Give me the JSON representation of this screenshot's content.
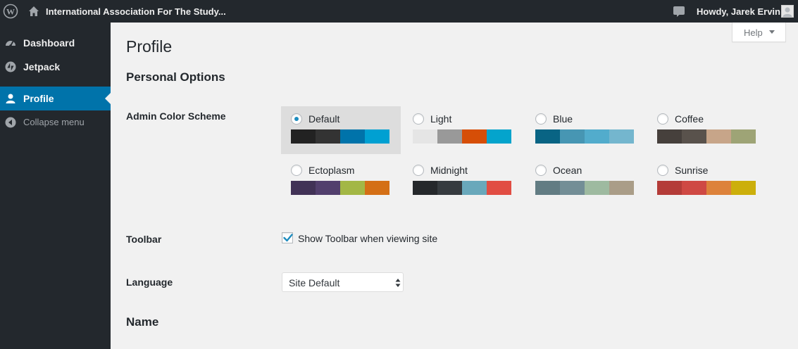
{
  "admin_bar": {
    "site_name": "International Association For The Study...",
    "greeting": "Howdy, Jarek Ervin"
  },
  "sidebar": {
    "items": [
      {
        "label": "Dashboard",
        "icon": "dashboard-icon"
      },
      {
        "label": "Jetpack",
        "icon": "jetpack-icon"
      },
      {
        "label": "Profile",
        "icon": "user-icon",
        "current": true
      },
      {
        "label": "Collapse menu",
        "icon": "collapse-icon"
      }
    ]
  },
  "help": {
    "label": "Help"
  },
  "page": {
    "title": "Profile",
    "personal_options_heading": "Personal Options",
    "admin_color_scheme_label": "Admin Color Scheme",
    "toolbar_label": "Toolbar",
    "toolbar_checkbox_label": "Show Toolbar when viewing site",
    "toolbar_checked": true,
    "language_label": "Language",
    "language_value": "Site Default",
    "name_heading": "Name"
  },
  "color_schemes": [
    {
      "name": "Default",
      "selected": true,
      "colors": [
        "#222222",
        "#333333",
        "#0073aa",
        "#00a0d2"
      ]
    },
    {
      "name": "Light",
      "selected": false,
      "colors": [
        "#e5e5e5",
        "#999999",
        "#d64e07",
        "#04a4cc"
      ]
    },
    {
      "name": "Blue",
      "selected": false,
      "colors": [
        "#096484",
        "#4796b3",
        "#52accc",
        "#74b6ce"
      ]
    },
    {
      "name": "Coffee",
      "selected": false,
      "colors": [
        "#46403c",
        "#59524c",
        "#c7a589",
        "#9ea476"
      ]
    },
    {
      "name": "Ectoplasm",
      "selected": false,
      "colors": [
        "#413256",
        "#523f6d",
        "#a3b745",
        "#d46f15"
      ]
    },
    {
      "name": "Midnight",
      "selected": false,
      "colors": [
        "#25282b",
        "#363b3f",
        "#69a8bb",
        "#e14d43"
      ]
    },
    {
      "name": "Ocean",
      "selected": false,
      "colors": [
        "#627c83",
        "#738e96",
        "#9ebaa0",
        "#aa9d88"
      ]
    },
    {
      "name": "Sunrise",
      "selected": false,
      "colors": [
        "#b43c38",
        "#cf4944",
        "#dd823b",
        "#ccaf0b"
      ]
    }
  ]
}
